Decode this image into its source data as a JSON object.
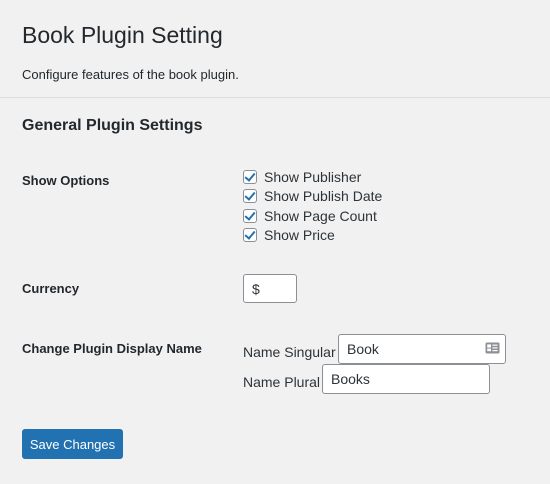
{
  "header": {
    "title": "Book Plugin Setting",
    "description": "Configure features of the book plugin."
  },
  "section": {
    "title": "General Plugin Settings"
  },
  "show_options": {
    "label": "Show Options",
    "items": [
      {
        "label": "Show Publisher",
        "checked": true
      },
      {
        "label": "Show Publish Date",
        "checked": true
      },
      {
        "label": "Show Page Count",
        "checked": true
      },
      {
        "label": "Show Price",
        "checked": true
      }
    ]
  },
  "currency": {
    "label": "Currency",
    "value": "$"
  },
  "display_name": {
    "label": "Change Plugin Display Name",
    "singular_label": "Name Singular",
    "singular_value": "Book",
    "plural_label": "Name Plural",
    "plural_value": "Books"
  },
  "actions": {
    "save_label": "Save Changes"
  },
  "colors": {
    "accent": "#2271b1",
    "background": "#f1f1f1",
    "text": "#23282d"
  }
}
